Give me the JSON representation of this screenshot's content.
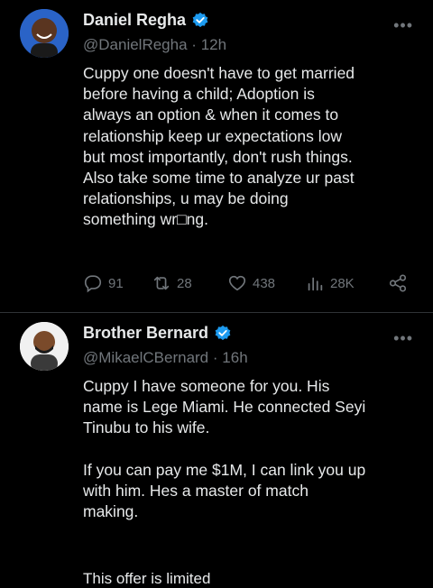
{
  "tweets": [
    {
      "author": "Daniel Regha",
      "handle": "@DanielRegha",
      "time": "12h",
      "text": "Cuppy one doesn't have to get married\nbefore having a child; Adoption is\nalways an option & when it comes to\nrelationship keep ur expectations low\nbut most importantly, don't rush things.\nAlso take some time to analyze ur past\nrelationships, u may be doing\nsomething wr□ng.",
      "replies": "91",
      "retweets": "28",
      "likes": "438",
      "views": "28K"
    },
    {
      "author": "Brother Bernard",
      "handle": "@MikaelCBernard",
      "time": "16h",
      "text": "Cuppy I have someone for you. His\nname is Lege Miami. He connected Seyi\nTinubu to his wife.\n\nIf you can pay me $1M, I can link you up\nwith him. Hes a master of match\nmaking.",
      "cut_line": "This offer is limited"
    }
  ],
  "ui": {
    "dot": "·",
    "more": "•••"
  },
  "colors": {
    "verified": "#1d9bf0",
    "muted": "#71767b",
    "text": "#e7e9ea",
    "background": "#000000"
  }
}
